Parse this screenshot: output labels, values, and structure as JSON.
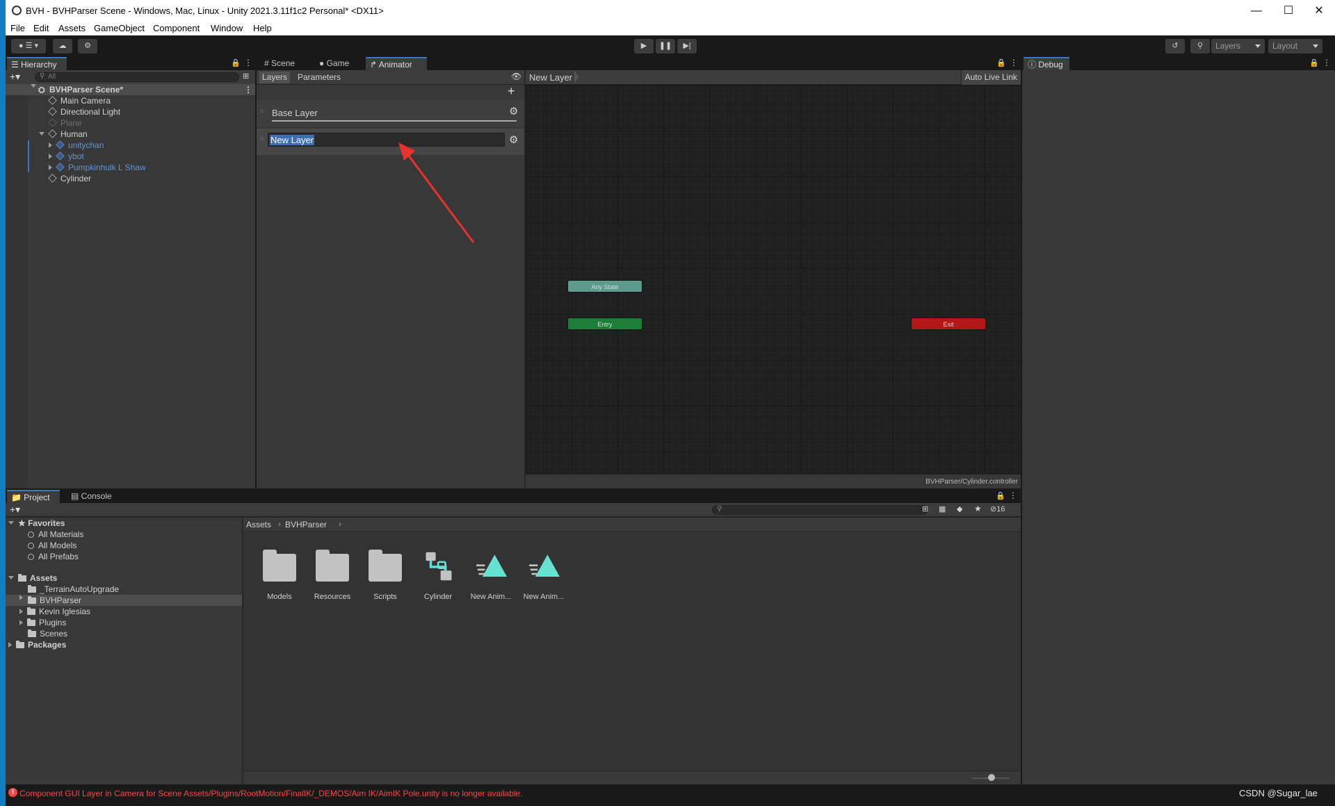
{
  "window": {
    "title": "BVH - BVHParser Scene - Windows, Mac, Linux - Unity 2021.3.11f1c2 Personal* <DX11>"
  },
  "menu": [
    "File",
    "Edit",
    "Assets",
    "GameObject",
    "Component",
    "Window",
    "Help"
  ],
  "toolbar": {
    "layers_label": "Layers",
    "layout_label": "Layout"
  },
  "hierarchy": {
    "tab": "Hierarchy",
    "search_placeholder": "All",
    "scene": "BVHParser Scene*",
    "items": [
      "Main Camera",
      "Directional Light",
      "Plane",
      "Human",
      "unitychan",
      "ybot",
      "Pumpkinhulk L Shaw",
      "Cylinder"
    ]
  },
  "center_tabs": {
    "scene": "Scene",
    "game": "Game",
    "animator": "Animator"
  },
  "animator": {
    "layers_tab": "Layers",
    "parameters_tab": "Parameters",
    "breadcrumb": "New Layer",
    "auto_live_link": "Auto Live Link",
    "base_layer": "Base Layer",
    "new_layer_value": "New Layer",
    "nodes": {
      "any_state": "Any State",
      "entry": "Entry",
      "exit": "Exit"
    },
    "controller_path": "BVHParser/Cylinder.controller"
  },
  "debug": {
    "tab": "Debug"
  },
  "project": {
    "tab_project": "Project",
    "tab_console": "Console",
    "favorites_label": "Favorites",
    "favorites": [
      "All Materials",
      "All Models",
      "All Prefabs"
    ],
    "assets_label": "Assets",
    "asset_folders": [
      "_TerrainAutoUpgrade",
      "BVHParser",
      "Kevin Iglesias",
      "Plugins",
      "Scenes"
    ],
    "packages_label": "Packages",
    "breadcrumb": [
      "Assets",
      "BVHParser"
    ],
    "hidden_count": "16",
    "grid_items": [
      "Models",
      "Resources",
      "Scripts",
      "Cylinder",
      "New Anim...",
      "New Anim..."
    ]
  },
  "status": {
    "message": "Component GUI Layer in Camera for Scene Assets/Plugins/RootMotion/FinalIK/_DEMOS/Aim IK/AimIK Pole.unity is no longer available.",
    "watermark": "CSDN @Sugar_lae"
  },
  "colors": {
    "accent": "#3a79bb",
    "any_state": "#5b9a8d",
    "entry": "#1b7f3a",
    "exit": "#b21818",
    "error": "#ff4545"
  }
}
